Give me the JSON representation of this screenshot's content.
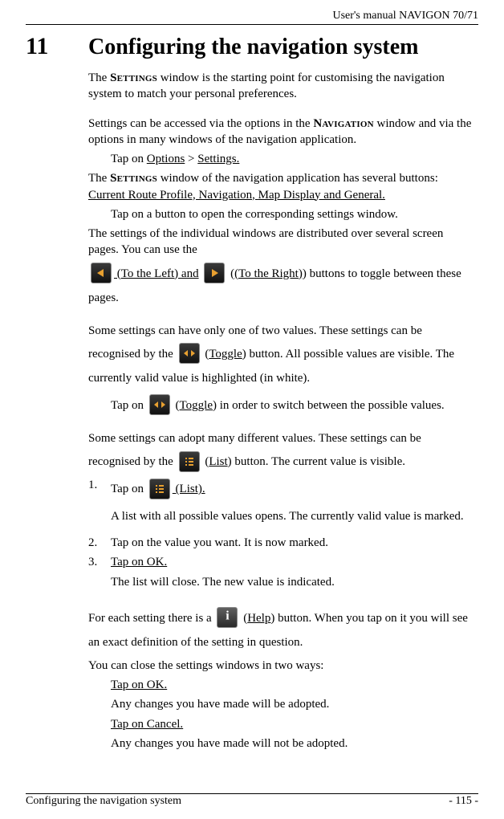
{
  "header": {
    "running": "User's manual NAVIGON 70/71"
  },
  "chapter": {
    "number": "11",
    "title": "Configuring the navigation system"
  },
  "text": {
    "intro1a": "The ",
    "settings_sc": "Settings",
    "intro1b": " window is the starting point for customising the navigation system to match your personal preferences.",
    "intro2a": "Settings can be accessed via the options in the ",
    "navigation_sc": "Navigation",
    "intro2b": " window and via the options in many windows of the navigation application.",
    "tap_options_a": "Tap on ",
    "options_ul": "Options",
    "gt": " > ",
    "settings_ul": "Settings.",
    "buttons_a": "The ",
    "buttons_b": " window of the navigation application has several buttons: ",
    "btn1": "Current Route Profile, ",
    "btn2": "Navigation, ",
    "btn3": "Map Display and",
    "btn4": " General.",
    "tap_button": "Tap on a button to open the corresponding settings window.",
    "distributed": "The settings of the individual windows are distributed over several screen pages. You can use the",
    "to_left": " (To the Left) and",
    "to_right": "(To the Right)",
    "toggle_tail": " buttons to toggle between these pages.",
    "two_values": "Some settings can have only one of two values. These settings can be",
    "recog_by": "recognised by the ",
    "toggle_lbl": "Toggle",
    "toggle_b": ") button. All possible values are visible. The currently valid value is highlighted (in white).",
    "tap_on": "Tap on ",
    "toggle_tail2": ") in order to switch between the possible values.",
    "many_values": "Some settings can adopt many different values. These settings can be",
    "list_lbl": "List",
    "list_b": ") button. The current value is visible.",
    "step1_a": "Tap on ",
    "step1_b": " (List).",
    "step1_sub": "A list with all possible values opens. The currently valid value is marked.",
    "step2": "Tap on the value you want. It is now marked.",
    "step3": "Tap on OK.",
    "step3_sub": "The list will close. The new value is indicated.",
    "help_a": "For each setting there is a ",
    "help_lbl": "Help",
    "help_b": ") button. When you tap on it you will see an exact definition of the setting in question.",
    "close": "You can close the settings windows in two ways:",
    "close_ok": "Tap on OK.",
    "close_ok_sub": "Any changes you have made will be adopted.",
    "close_cancel": "Tap on Cancel.",
    "close_cancel_sub": "Any changes you have made will not be adopted."
  },
  "ol": {
    "n1": "1.",
    "n2": "2.",
    "n3": "3."
  },
  "footer": {
    "left": "Configuring the navigation system",
    "right": "- 115 -"
  }
}
